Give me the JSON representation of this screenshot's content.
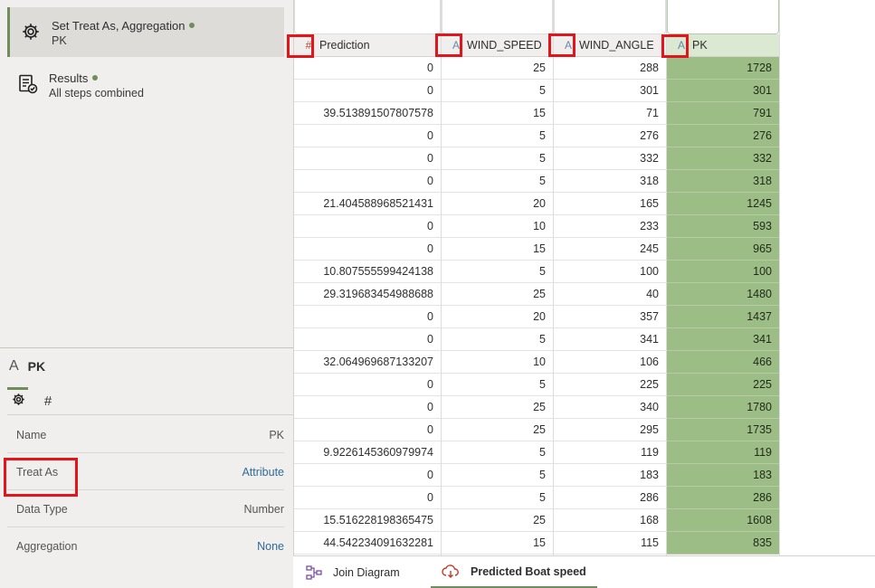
{
  "steps": [
    {
      "title": "Set Treat As, Aggregation",
      "subtitle": "PK",
      "icon": "gear-icon",
      "active": true
    },
    {
      "title": "Results",
      "subtitle": "All steps combined",
      "icon": "results-checklist-icon",
      "active": false
    }
  ],
  "properties": {
    "type_glyph": "A",
    "column_name": "PK",
    "tabs": [
      {
        "icon": "gear-icon",
        "glyph": "⚙"
      },
      {
        "icon": "hash-icon",
        "glyph": "#"
      }
    ],
    "rows": [
      {
        "label": "Name",
        "value": "PK",
        "link": false
      },
      {
        "label": "Treat As",
        "value": "Attribute",
        "link": true
      },
      {
        "label": "Data Type",
        "value": "Number",
        "link": false
      },
      {
        "label": "Aggregation",
        "value": "None",
        "link": true
      }
    ]
  },
  "grid": {
    "columns": [
      {
        "name": "Prediction",
        "type_glyph": "#",
        "type": "measure"
      },
      {
        "name": "WIND_SPEED",
        "type_glyph": "A",
        "type": "attribute"
      },
      {
        "name": "WIND_ANGLE",
        "type_glyph": "A",
        "type": "attribute"
      },
      {
        "name": "PK",
        "type_glyph": "A",
        "type": "attribute"
      }
    ],
    "rows": [
      [
        "0",
        "25",
        "288",
        "1728"
      ],
      [
        "0",
        "5",
        "301",
        "301"
      ],
      [
        "39.513891507807578",
        "15",
        "71",
        "791"
      ],
      [
        "0",
        "5",
        "276",
        "276"
      ],
      [
        "0",
        "5",
        "332",
        "332"
      ],
      [
        "0",
        "5",
        "318",
        "318"
      ],
      [
        "21.404588968521431",
        "20",
        "165",
        "1245"
      ],
      [
        "0",
        "10",
        "233",
        "593"
      ],
      [
        "0",
        "15",
        "245",
        "965"
      ],
      [
        "10.807555599424138",
        "5",
        "100",
        "100"
      ],
      [
        "29.319683454988688",
        "25",
        "40",
        "1480"
      ],
      [
        "0",
        "20",
        "357",
        "1437"
      ],
      [
        "0",
        "5",
        "341",
        "341"
      ],
      [
        "32.064969687133207",
        "10",
        "106",
        "466"
      ],
      [
        "0",
        "5",
        "225",
        "225"
      ],
      [
        "0",
        "25",
        "340",
        "1780"
      ],
      [
        "0",
        "25",
        "295",
        "1735"
      ],
      [
        "9.9226145360979974",
        "5",
        "119",
        "119"
      ],
      [
        "0",
        "5",
        "183",
        "183"
      ],
      [
        "0",
        "5",
        "286",
        "286"
      ],
      [
        "15.516228198365475",
        "25",
        "168",
        "1608"
      ],
      [
        "44.542234091632281",
        "15",
        "115",
        "835"
      ]
    ]
  },
  "bottom_tabs": [
    {
      "label": "Join Diagram",
      "icon": "join-diagram-icon",
      "active": false
    },
    {
      "label": "Predicted Boat speed",
      "icon": "dataflow-cloud-icon",
      "active": true
    }
  ],
  "colors": {
    "accent": "#6f8e59",
    "highlight_column": "#9dbd87",
    "annotation": "#e4141b"
  }
}
